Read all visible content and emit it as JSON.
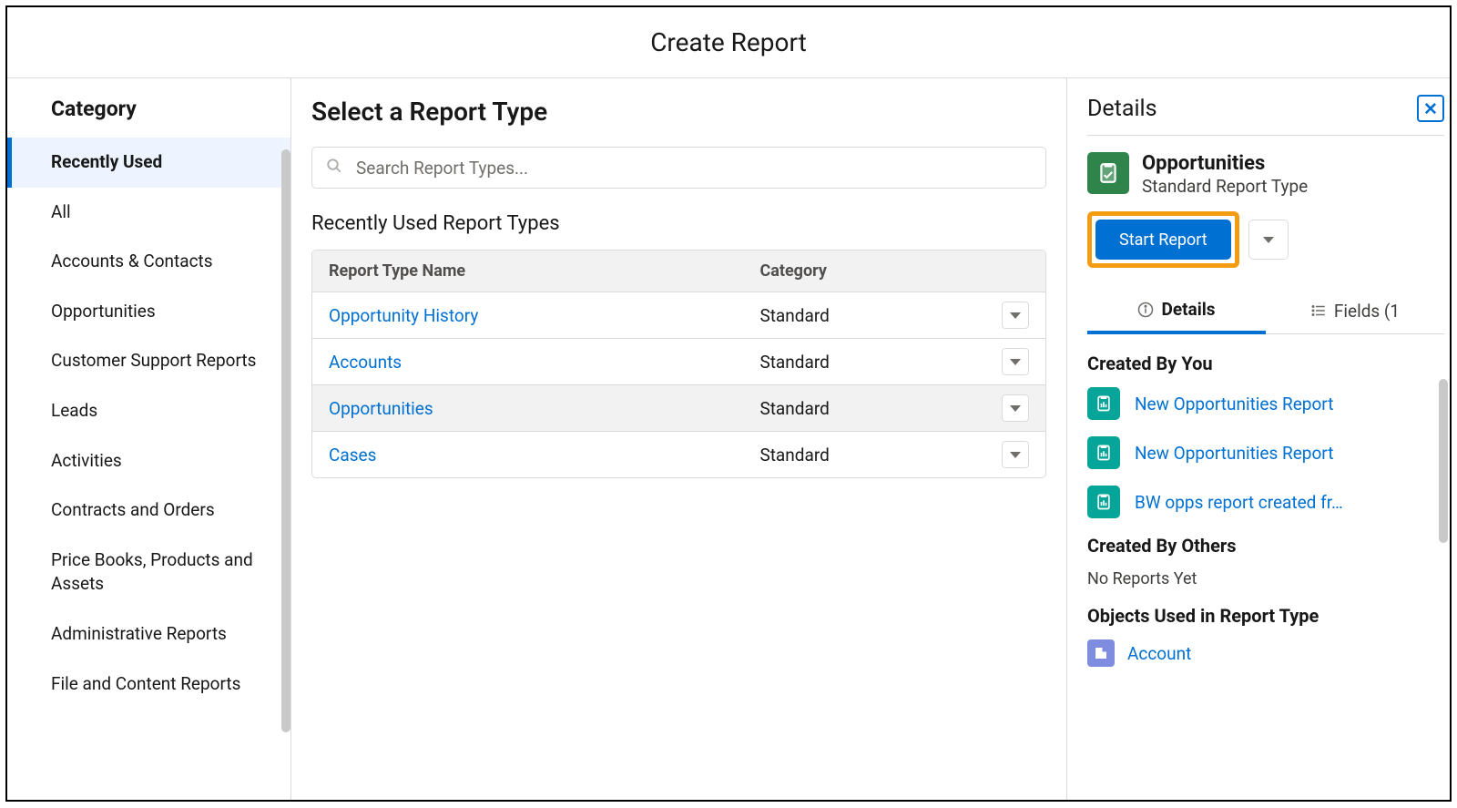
{
  "header": {
    "title": "Create Report"
  },
  "sidebar": {
    "heading": "Category",
    "items": [
      {
        "label": "Recently Used",
        "active": true
      },
      {
        "label": "All"
      },
      {
        "label": "Accounts & Contacts"
      },
      {
        "label": "Opportunities"
      },
      {
        "label": "Customer Support Reports"
      },
      {
        "label": "Leads"
      },
      {
        "label": "Activities"
      },
      {
        "label": "Contracts and Orders"
      },
      {
        "label": "Price Books, Products and Assets"
      },
      {
        "label": "Administrative Reports"
      },
      {
        "label": "File and Content Reports"
      }
    ]
  },
  "main": {
    "heading": "Select a Report Type",
    "search_placeholder": "Search Report Types...",
    "list_heading": "Recently Used Report Types",
    "columns": {
      "name": "Report Type Name",
      "category": "Category"
    },
    "rows": [
      {
        "name": "Opportunity History",
        "category": "Standard"
      },
      {
        "name": "Accounts",
        "category": "Standard"
      },
      {
        "name": "Opportunities",
        "category": "Standard",
        "selected": true
      },
      {
        "name": "Cases",
        "category": "Standard"
      }
    ]
  },
  "details": {
    "heading": "Details",
    "selected": {
      "title": "Opportunities",
      "subtitle": "Standard Report Type"
    },
    "start_label": "Start Report",
    "tabs": {
      "details": "Details",
      "fields": "Fields (1"
    },
    "created_by_you": {
      "heading": "Created By You",
      "items": [
        "New Opportunities Report",
        "New Opportunities Report",
        "BW opps report created fr…"
      ]
    },
    "created_by_others": {
      "heading": "Created By Others",
      "text": "No Reports Yet"
    },
    "objects": {
      "heading": "Objects Used in Report Type",
      "items": [
        "Account"
      ]
    }
  }
}
